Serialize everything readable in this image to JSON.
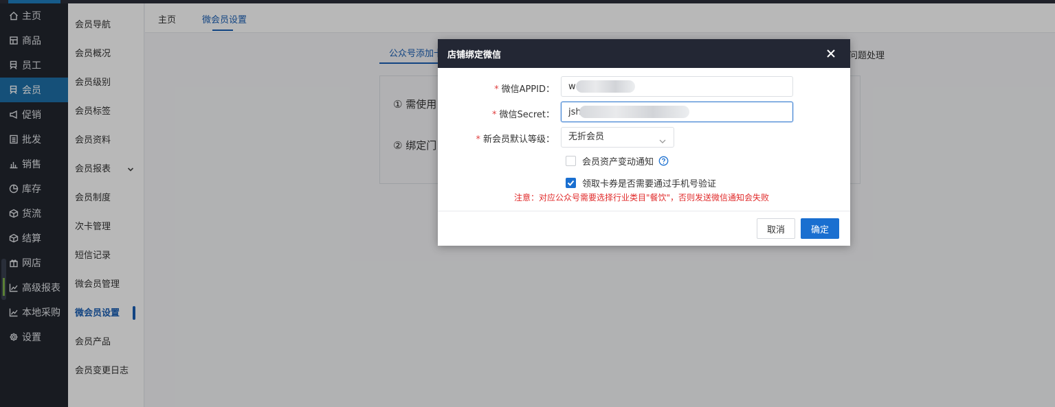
{
  "sidebar": {
    "items": [
      {
        "label": "主页",
        "icon": "home-icon",
        "active": false
      },
      {
        "label": "商品",
        "icon": "goods-icon",
        "active": false
      },
      {
        "label": "员工",
        "icon": "staff-icon",
        "active": false
      },
      {
        "label": "会员",
        "icon": "member-icon",
        "active": true
      },
      {
        "label": "促销",
        "icon": "megaphone-icon",
        "active": false
      },
      {
        "label": "批发",
        "icon": "list-icon",
        "active": false
      },
      {
        "label": "销售",
        "icon": "bar-chart-icon",
        "active": false
      },
      {
        "label": "库存",
        "icon": "pie-chart-icon",
        "active": false
      },
      {
        "label": "货流",
        "icon": "box-icon",
        "active": false
      },
      {
        "label": "结算",
        "icon": "cube-icon",
        "active": false
      },
      {
        "label": "网店",
        "icon": "gift-icon",
        "active": false
      },
      {
        "label": "高级报表",
        "icon": "line-chart-icon",
        "active": false
      },
      {
        "label": "本地采购",
        "icon": "line-chart-icon",
        "active": false
      },
      {
        "label": "设置",
        "icon": "gear-icon",
        "active": false
      }
    ]
  },
  "subnav": {
    "items": [
      {
        "label": "会员导航"
      },
      {
        "label": "会员概况"
      },
      {
        "label": "会员级别"
      },
      {
        "label": "会员标签"
      },
      {
        "label": "会员资料"
      },
      {
        "label": "会员报表"
      },
      {
        "label": "会员制度"
      },
      {
        "label": "次卡管理"
      },
      {
        "label": "短信记录"
      },
      {
        "label": "微会员管理"
      },
      {
        "label": "微会员设置"
      },
      {
        "label": "会员产品"
      },
      {
        "label": "会员变更日志"
      }
    ]
  },
  "tabs": {
    "home": "主页",
    "current": "微会员设置"
  },
  "panel": {
    "inner_tab_left": "公众号添加卡",
    "inner_tab_right": "问题处理",
    "line1": "① 需使用",
    "line2": "② 绑定门"
  },
  "modal": {
    "title": "店铺绑定微信",
    "appid_label": "微信APPID：",
    "appid_value": "w",
    "secret_label": "微信Secret：",
    "secret_value": "jsh",
    "level_label": "新会员默认等级：",
    "level_value": "无折会员",
    "notify_label": "会员资产变动通知",
    "notify_checked": false,
    "verify_label": "领取卡券是否需要通过手机号验证",
    "verify_checked": true,
    "notice": "注意：对应公众号需要选择行业类目\"餐饮\"，否则发送微信通知会失败",
    "cancel": "取消",
    "ok": "确定"
  },
  "colors": {
    "sidebar_bg": "#22262f",
    "sidebar_active": "#1e6fa8",
    "accent": "#1a6fd0",
    "modal_header": "#232734",
    "notice": "#e02a2a"
  }
}
